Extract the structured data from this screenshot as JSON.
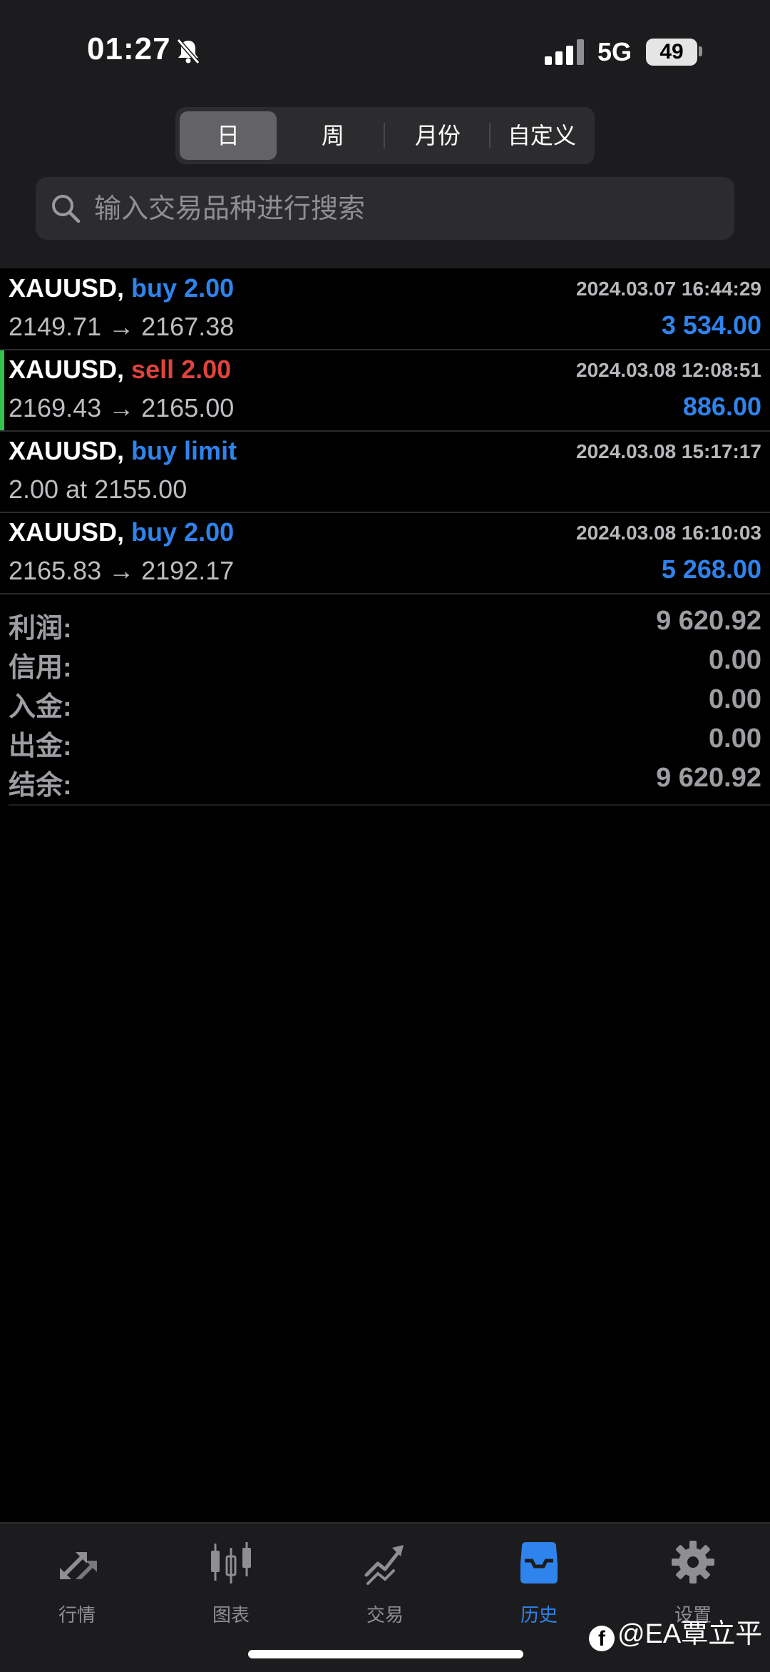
{
  "status_bar": {
    "time": "01:27",
    "network": "5G",
    "battery": "49"
  },
  "period_tabs": [
    {
      "label": "日",
      "active": true
    },
    {
      "label": "周",
      "active": false
    },
    {
      "label": "月份",
      "active": false
    },
    {
      "label": "自定义",
      "active": false
    }
  ],
  "search": {
    "placeholder": "输入交易品种进行搜索"
  },
  "deals": [
    {
      "symbol": "XAUUSD,",
      "side": "buy 2.00",
      "side_type": "buy",
      "time": "2024.03.07 16:44:29",
      "prices": "2149.71 → 2167.38",
      "profit": "3 534.00"
    },
    {
      "symbol": "XAUUSD,",
      "side": "sell 2.00",
      "side_type": "sell",
      "time": "2024.03.08 12:08:51",
      "prices": "2169.43 → 2165.00",
      "profit": "886.00"
    },
    {
      "symbol": "XAUUSD,",
      "side": "buy limit",
      "side_type": "buy",
      "time": "2024.03.08 15:17:17",
      "prices": "2.00 at 2155.00",
      "profit": ""
    },
    {
      "symbol": "XAUUSD,",
      "side": "buy 2.00",
      "side_type": "buy",
      "time": "2024.03.08 16:10:03",
      "prices": "2165.83 → 2192.17",
      "profit": "5 268.00"
    }
  ],
  "summary": [
    {
      "label": "利润:",
      "value": "9 620.92"
    },
    {
      "label": "信用:",
      "value": "0.00"
    },
    {
      "label": "入金:",
      "value": "0.00"
    },
    {
      "label": "出金:",
      "value": "0.00"
    },
    {
      "label": "结余:",
      "value": "9 620.92"
    }
  ],
  "tabbar": [
    {
      "label": "行情",
      "icon": "quotes-arrows-icon",
      "active": false
    },
    {
      "label": "图表",
      "icon": "candlestick-chart-icon",
      "active": false
    },
    {
      "label": "交易",
      "icon": "trade-chart-icon",
      "active": false
    },
    {
      "label": "历史",
      "icon": "history-inbox-icon",
      "active": true
    },
    {
      "label": "设置",
      "icon": "gear-icon",
      "active": false
    }
  ],
  "watermark": "@EA覃立平",
  "colors": {
    "buy": "#2f83ec",
    "sell": "#e0443c",
    "active_tab": "#2f83ec",
    "selected_marker": "#33c24d"
  }
}
